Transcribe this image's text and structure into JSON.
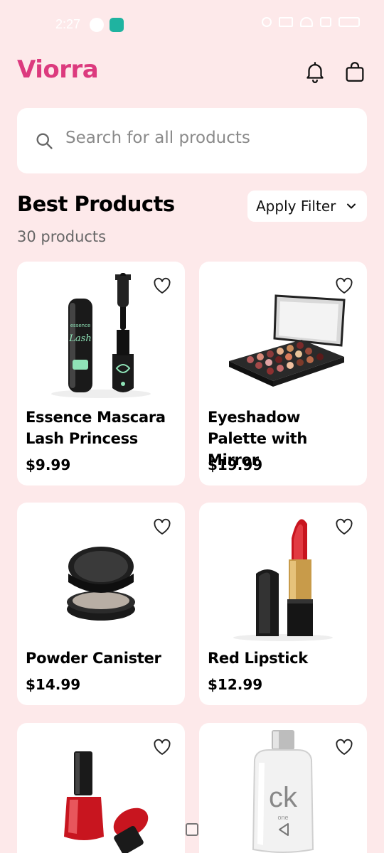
{
  "status": {
    "time": "2:27"
  },
  "header": {
    "brand": "Viorra"
  },
  "search": {
    "placeholder": "Search for all products"
  },
  "section": {
    "title": "Best Products",
    "count": "30 products"
  },
  "filter": {
    "label": "Apply Filter"
  },
  "products": [
    {
      "name": "Essence Mascara Lash Princess",
      "price": "$9.99",
      "image": "mascara"
    },
    {
      "name": "Eyeshadow Palette with Mirror",
      "price": "$19.99",
      "image": "eyeshadow-palette"
    },
    {
      "name": "Powder Canister",
      "price": "$14.99",
      "image": "powder-compact"
    },
    {
      "name": "Red Lipstick",
      "price": "$12.99",
      "image": "lipstick"
    },
    {
      "name": "",
      "price": "",
      "image": "nail-polish"
    },
    {
      "name": "",
      "price": "",
      "image": "ck-perfume"
    }
  ],
  "colors": {
    "brand": "#dc3a7e",
    "background": "#fde9ea",
    "card": "#ffffff"
  }
}
